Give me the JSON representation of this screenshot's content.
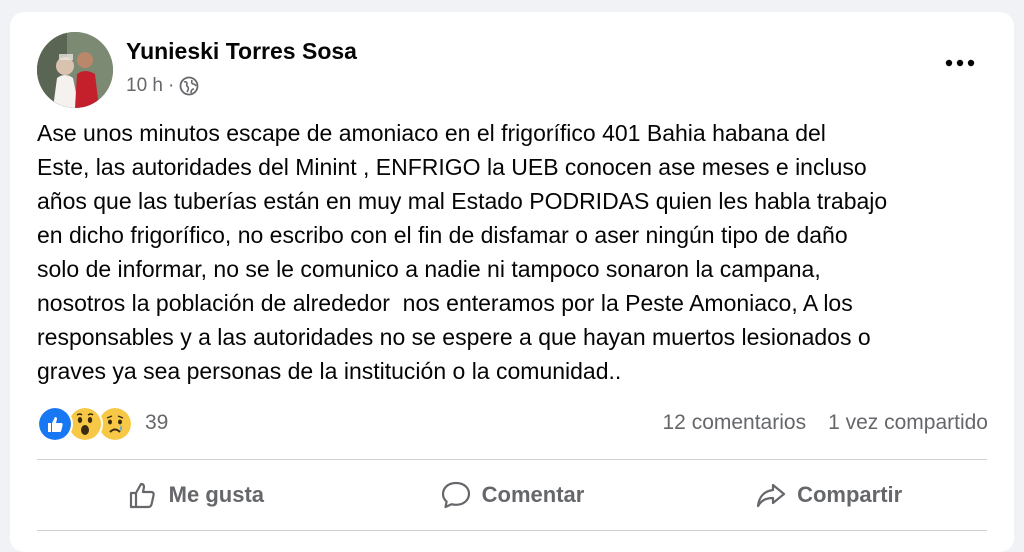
{
  "post": {
    "author": "Yunieski Torres Sosa",
    "time": "10 h",
    "separator": "·",
    "body_lines": [
      "Ase unos minutos escape de amoniaco en el frigorífico 401 Bahia habana del",
      "Este, las autoridades del Minint , ENFRIGO la UEB conocen ase meses e incluso",
      "años que las tuberías están en muy mal Estado PODRIDAS quien les habla trabajo",
      "en dicho frigorífico, no escribo con el fin de disfamar o aser ningún tipo de daño",
      "solo de informar, no se le comunico a nadie ni tampoco sonaron la campana,",
      "nosotros la población de alrededor  nos enteramos por la Peste Amoniaco, A los",
      "responsables y a las autoridades no se espere a que hayan muertos lesionados o",
      "graves ya sea personas de la institución o la comunidad.."
    ]
  },
  "reactions": {
    "count": "39",
    "icons": [
      "like-icon",
      "wow-icon",
      "sad-icon"
    ]
  },
  "stats": {
    "comments": "12 comentarios",
    "shares": "1 vez compartido"
  },
  "actions": {
    "like": "Me gusta",
    "comment": "Comentar",
    "share": "Compartir"
  },
  "colors": {
    "like_blue": "#1877f2",
    "emoji_yellow": "#f7c846",
    "secondary_text": "#65676b"
  }
}
